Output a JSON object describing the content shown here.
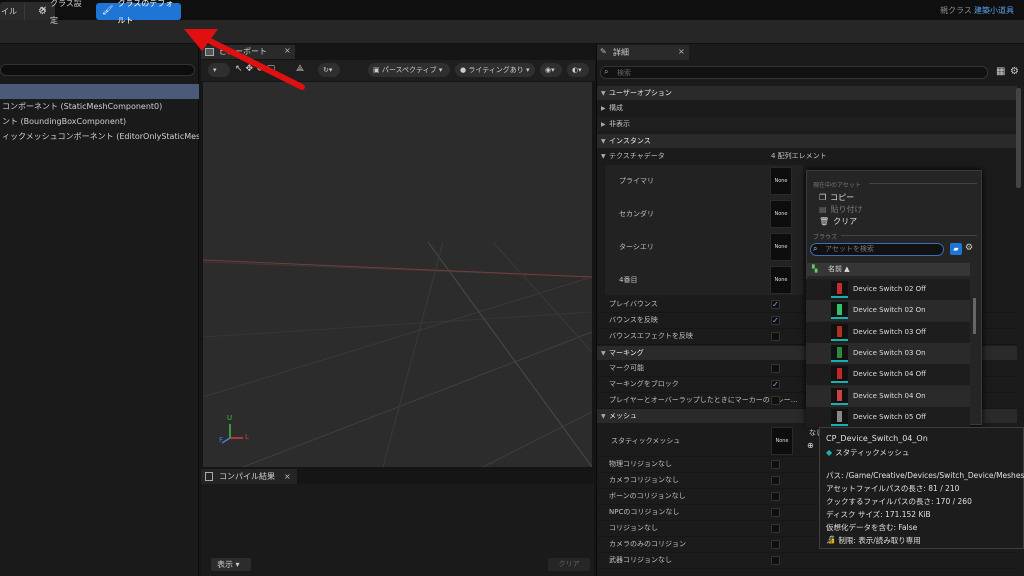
{
  "window": {
    "doc_tab_close": "×",
    "parent_class_label": "親クラス",
    "parent_class_value": "建築小道具"
  },
  "toolbar": {
    "file_label": "イル",
    "class_settings_label": "クラス設定",
    "class_defaults_label": "クラスのデフォルト"
  },
  "components": [
    "コンポーネント (StaticMeshComponent0)",
    "ント (BoundingBoxComponent)",
    "ィックメッシュコンポーネント (EditorOnlyStaticMeshComp"
  ],
  "viewport": {
    "tab_label": "ビューポート",
    "perspective_label": "パースペクティブ",
    "lighting_label": "ライティングあり",
    "axis_labels": {
      "up": "U",
      "forward": "F",
      "left": "L"
    }
  },
  "compile": {
    "tab_label": "コンパイル結果",
    "show_label": "表示",
    "clear_label": "クリア"
  },
  "details": {
    "tab_label": "詳細",
    "search_placeholder": "検索",
    "categories": {
      "user_options": "ユーザーオプション",
      "composition": "構成",
      "hidden": "非表示",
      "instances": "インスタンス",
      "marking": "マーキング",
      "mesh": "メッシュ"
    },
    "texture_data": {
      "label": "テクスチャデータ",
      "value": "4 配列エレメント"
    },
    "texture_slots": [
      {
        "label": "プライマリ",
        "thumb": "None"
      },
      {
        "label": "セカンダリ",
        "thumb": "None"
      },
      {
        "label": "ターシエリ",
        "thumb": "None"
      },
      {
        "label": "4番目",
        "thumb": "None"
      }
    ],
    "flags": [
      {
        "label": "プレイバウンス",
        "checked": true
      },
      {
        "label": "バウンスを反映",
        "checked": true
      },
      {
        "label": "バウンスエフェクトを反映",
        "checked": false
      }
    ],
    "marking_flags": [
      {
        "label": "マーク可能",
        "checked": false
      },
      {
        "label": "マーキングをブロック",
        "checked": true
      },
      {
        "label": "プレイヤーとオーバーラップしたときにマーカーのトレー...",
        "checked": false
      }
    ],
    "static_mesh": {
      "label": "スタティックメッシュ",
      "thumb": "None",
      "value": "なし"
    },
    "collision_flags": [
      "物理コリジョンなし",
      "カメラコリジョンなし",
      "ボーンのコリジョンなし",
      "NPCのコリジョンなし",
      "コリジョンなし",
      "カメラのみのコリジョン",
      "武器コリジョンなし"
    ]
  },
  "picker": {
    "current_asset_heading": "現在中のアセット",
    "copy_label": "コピー",
    "paste_label": "貼り付け",
    "clear_label": "クリア",
    "browse_heading": "ブラウズ",
    "search_placeholder": "アセットを検索",
    "name_column": "名前 ▲",
    "assets": [
      {
        "name": "Device Switch 02 Off",
        "color": "#c0302a"
      },
      {
        "name": "Device Switch 02 On",
        "color": "#2fc46a"
      },
      {
        "name": "Device Switch 03 Off",
        "color": "#b03020"
      },
      {
        "name": "Device Switch 03 On",
        "color": "#2a8a40"
      },
      {
        "name": "Device Switch 04 Off",
        "color": "#c02828"
      },
      {
        "name": "Device Switch 04 On",
        "color": "#d04040"
      },
      {
        "name": "Device Switch 05 Off",
        "color": "#888888"
      }
    ]
  },
  "tooltip": {
    "asset_name": "CP_Device_Switch_04_On",
    "asset_type": "スタティックメッシュ",
    "path": "パス: /Game/Creative/Devices/Switch_Device/Meshes",
    "asset_path_len": "アセットファイルパスの長さ: 81 / 210",
    "cooked_path_len": "クックするファイルパスの長さ: 170 / 260",
    "disk_size": "ディスク サイズ: 171.152 KiB",
    "virtualized": "仮想化データを含む: False",
    "restriction": "制限: 表示/読み取り専用"
  },
  "colors": {
    "accent": "#1f75d6",
    "arrow": "#e01010"
  }
}
